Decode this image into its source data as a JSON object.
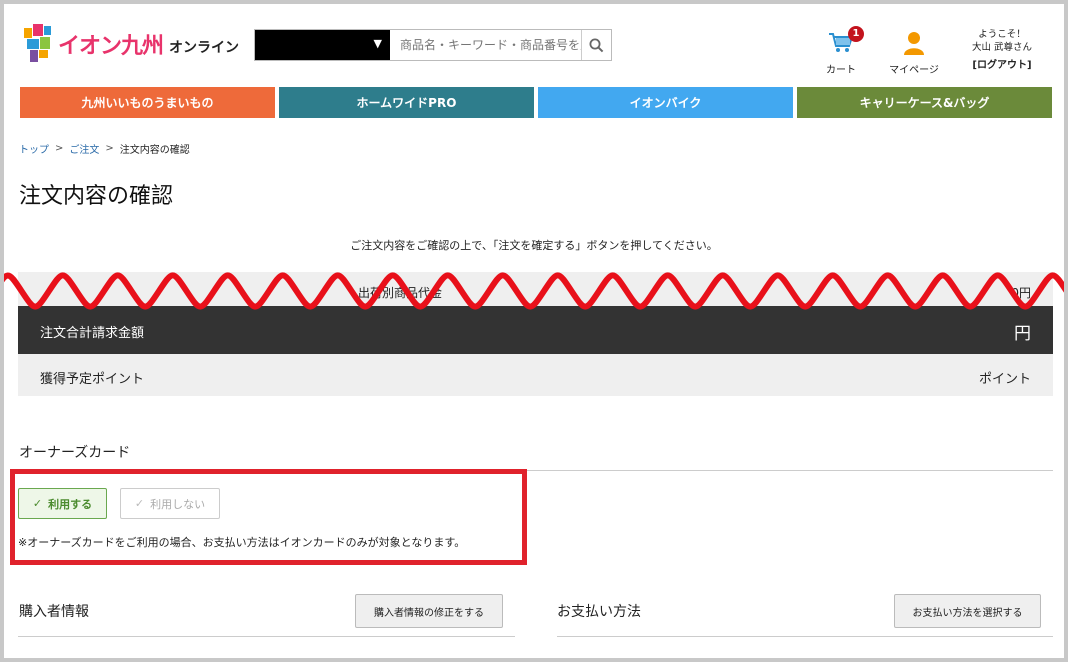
{
  "header": {
    "logo_text": "イオン九州",
    "logo_sub": "オンライン",
    "search": {
      "select_value": "",
      "placeholder": "商品名・キーワード・商品番号を入力"
    },
    "cart": {
      "label": "カート",
      "count": "1"
    },
    "mypage": {
      "label": "マイページ"
    },
    "greeting": "ようこそ！",
    "user_name": "大山 武尊さん",
    "logout": "[ログアウト]"
  },
  "nav": [
    {
      "label": "九州いいものうまいもの",
      "color": "#ee6a3a"
    },
    {
      "label": "ホームワイドPRO",
      "color": "#2e7d8c"
    },
    {
      "label": "イオンバイク",
      "color": "#42a8f0"
    },
    {
      "label": "キャリーケース&バッグ",
      "color": "#6b8a3a"
    }
  ],
  "breadcrumb": {
    "items": [
      "トップ",
      "ご注文"
    ],
    "current": "注文内容の確認"
  },
  "page_title": "注文内容の確認",
  "intro": "ご注文内容をご確認の上で、「注文を確定する」ボタンを押してください。",
  "summary": {
    "cut_row_label": "出荷別商品代金",
    "cut_row_value": "0円",
    "total_label": "注文合計請求金額",
    "total_value": "円",
    "points_label": "獲得予定ポイント",
    "points_value": "ポイント"
  },
  "owners_card": {
    "heading": "オーナーズカード",
    "use_label": "利用する",
    "nouse_label": "利用しない",
    "note": "※オーナーズカードをご利用の場合、お支払い方法はイオンカードのみが対象となります。"
  },
  "buyer": {
    "heading": "購入者情報",
    "button": "購入者情報の修正をする"
  },
  "payment": {
    "heading": "お支払い方法",
    "button": "お支払い方法を選択する"
  },
  "colors": {
    "highlight_red": "#e0222c",
    "wave_red": "#e8101a",
    "use_green": "#4b8b2e"
  }
}
